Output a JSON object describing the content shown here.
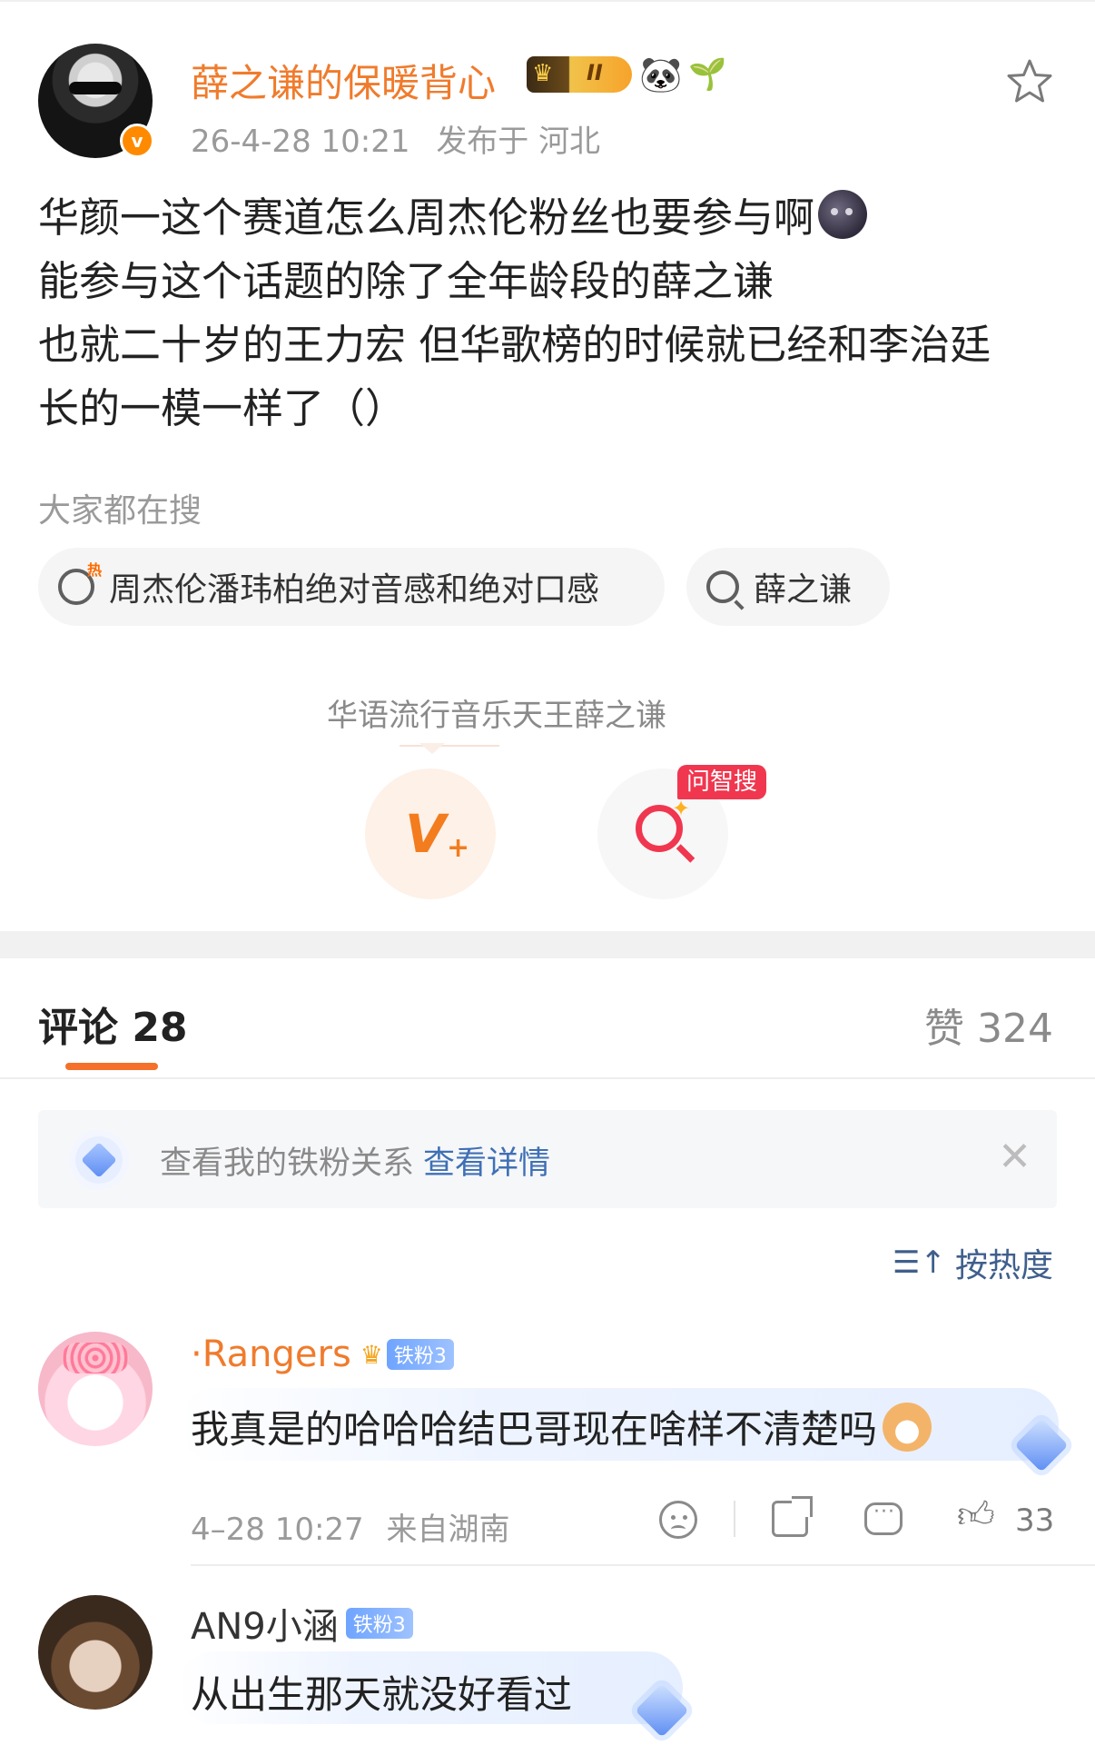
{
  "post": {
    "username": "薛之谦的保暖背心",
    "vip_level": "II",
    "timestamp": "26-4-28 10:21",
    "published_in": "发布于 河北",
    "verified_mark": "v",
    "body_lines": [
      "华颜一这个赛道怎么周杰伦粉丝也要参与啊",
      "能参与这个话题的除了全年龄段的薛之谦",
      "也就二十岁的王力宏 但华歌榜的时候就已经和李治廷",
      "长的一模一样了（）"
    ]
  },
  "trending": {
    "title": "大家都在搜",
    "chips": [
      {
        "label": "周杰伦潘玮柏绝对音感和绝对口感",
        "icon": "hot-search-icon"
      },
      {
        "label": "薛之谦",
        "icon": "search-icon"
      }
    ]
  },
  "super_topic": {
    "label": "华语流行音乐天王薛之谦",
    "ai_badge": "问智搜"
  },
  "comments_header": {
    "tab": "评论 28",
    "likes": "赞 324"
  },
  "fan_banner": {
    "text": "查看我的铁粉关系",
    "link": "查看详情"
  },
  "sort": {
    "label": "按热度"
  },
  "comments": [
    {
      "name": "·Rangers",
      "badge": "铁粉3",
      "text": "我真是的哈哈哈结巴哥现在啥样不清楚吗",
      "time": "4–28 10:27",
      "location": "来自湖南",
      "likes": "33"
    },
    {
      "name": "AN9小涵",
      "badge": "铁粉3",
      "text": "从出生那天就没好看过"
    }
  ],
  "colors": {
    "accent_orange": "#f07b2c",
    "link_blue": "#3f70b5",
    "ai_red": "#f0374f"
  }
}
